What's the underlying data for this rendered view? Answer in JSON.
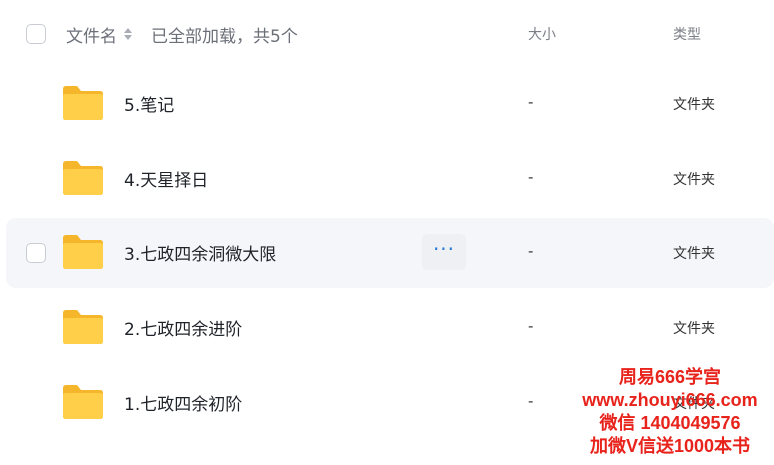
{
  "header": {
    "name_label": "文件名",
    "loaded_label": "已全部加载，共5个",
    "size_label": "大小",
    "type_label": "类型"
  },
  "files": [
    {
      "name": "5.笔记",
      "size": "-",
      "type": "文件夹"
    },
    {
      "name": "4.天星择日",
      "size": "-",
      "type": "文件夹"
    },
    {
      "name": "3.七政四余洞微大限",
      "size": "-",
      "type": "文件夹"
    },
    {
      "name": "2.七政四余进阶",
      "size": "-",
      "type": "文件夹"
    },
    {
      "name": "1.七政四余初阶",
      "size": "-",
      "type": "文件夹"
    }
  ],
  "row_actions": {
    "more_label": "···"
  },
  "watermark": {
    "line1": "周易666学宫",
    "line2": "www.zhouyi666.com",
    "line3": "微信 1404049576",
    "line4": "加微V信送1000本书"
  },
  "colors": {
    "folder": "#ffc93d",
    "hover_row": "#f5f6f9",
    "accent": "#2a7bd8",
    "watermark": "#e8231c"
  }
}
